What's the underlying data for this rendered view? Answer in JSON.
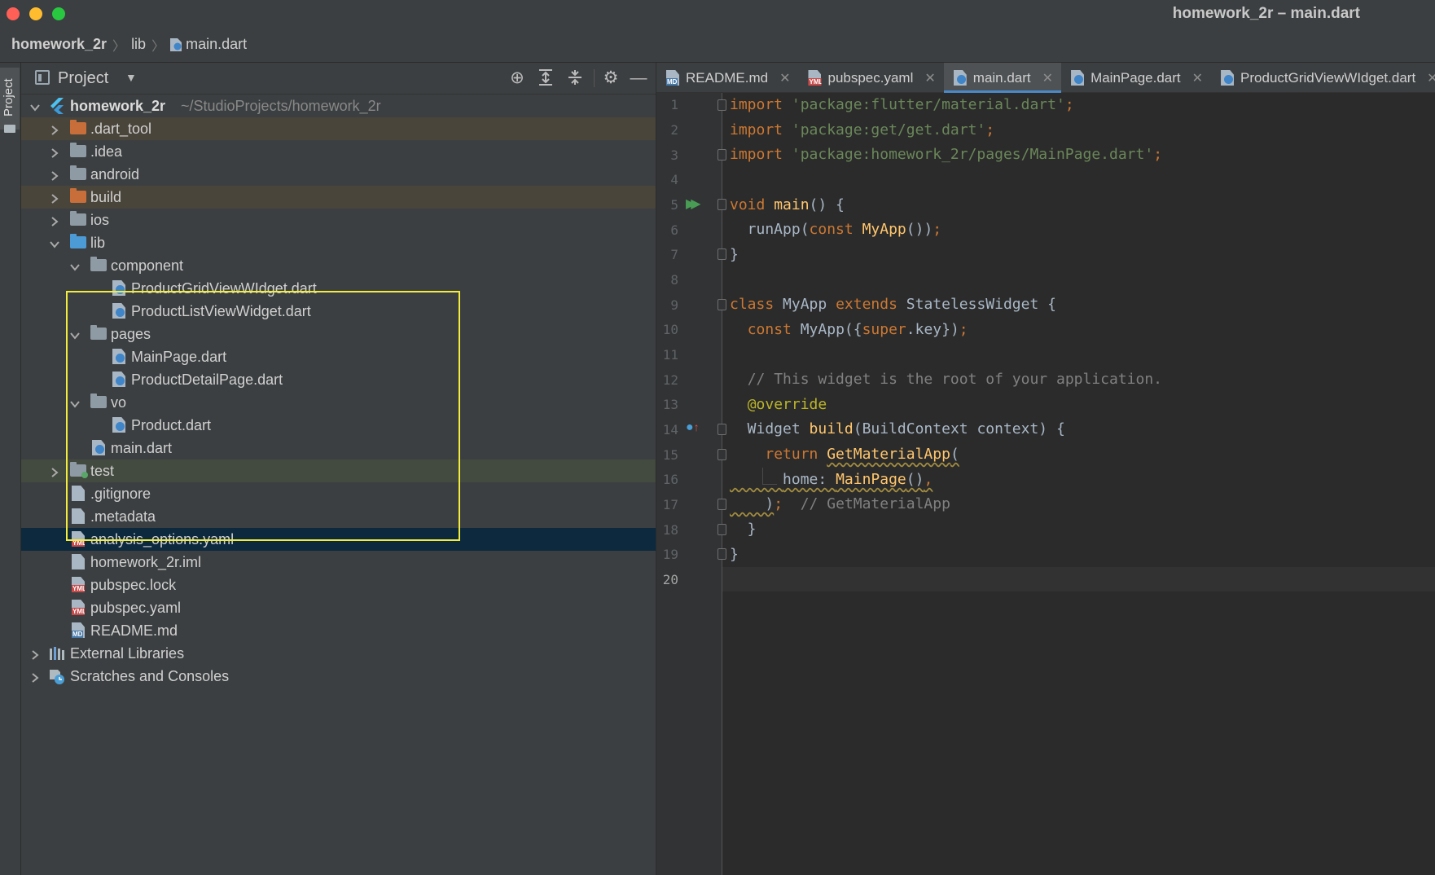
{
  "window": {
    "title": "homework_2r – main.dart"
  },
  "breadcrumb": [
    "homework_2r",
    "lib",
    "main.dart"
  ],
  "sidebar_strip": {
    "label": "Project"
  },
  "project_panel": {
    "title": "Project",
    "tree": [
      {
        "label": "homework_2r",
        "suffix": "~/StudioProjects/homework_2r",
        "type": "module",
        "depth": 0,
        "expanded": true
      },
      {
        "label": ".dart_tool",
        "type": "folder-excluded",
        "depth": 1,
        "expanded": false
      },
      {
        "label": ".idea",
        "type": "folder-config",
        "depth": 1,
        "expanded": false
      },
      {
        "label": "android",
        "type": "folder",
        "depth": 1,
        "expanded": false
      },
      {
        "label": "build",
        "type": "folder-excluded",
        "depth": 1,
        "expanded": false
      },
      {
        "label": "ios",
        "type": "folder",
        "depth": 1,
        "expanded": false
      },
      {
        "label": "lib",
        "type": "folder-source",
        "depth": 1,
        "expanded": true
      },
      {
        "label": "component",
        "type": "folder",
        "depth": 2,
        "expanded": true
      },
      {
        "label": "ProductGridViewWIdget.dart",
        "type": "dart",
        "depth": 3
      },
      {
        "label": "ProductListViewWidget.dart",
        "type": "dart",
        "depth": 3
      },
      {
        "label": "pages",
        "type": "folder",
        "depth": 2,
        "expanded": true
      },
      {
        "label": "MainPage.dart",
        "type": "dart",
        "depth": 3
      },
      {
        "label": "ProductDetailPage.dart",
        "type": "dart",
        "depth": 3
      },
      {
        "label": "vo",
        "type": "folder",
        "depth": 2,
        "expanded": true
      },
      {
        "label": "Product.dart",
        "type": "dart",
        "depth": 3
      },
      {
        "label": "main.dart",
        "type": "dart",
        "depth": 2
      },
      {
        "label": "test",
        "type": "folder-test",
        "depth": 1,
        "expanded": false
      },
      {
        "label": ".gitignore",
        "type": "file",
        "depth": 1
      },
      {
        "label": ".metadata",
        "type": "file",
        "depth": 1
      },
      {
        "label": "analysis_options.yaml",
        "type": "yml",
        "depth": 1,
        "selected": true
      },
      {
        "label": "homework_2r.iml",
        "type": "file",
        "depth": 1
      },
      {
        "label": "pubspec.lock",
        "type": "yml",
        "depth": 1
      },
      {
        "label": "pubspec.yaml",
        "type": "yml",
        "depth": 1
      },
      {
        "label": "README.md",
        "type": "md",
        "depth": 1
      },
      {
        "label": "External Libraries",
        "type": "libraries",
        "depth": 0,
        "expanded": false
      },
      {
        "label": "Scratches and Consoles",
        "type": "scratches",
        "depth": 0,
        "expanded": false
      }
    ]
  },
  "tabs": [
    {
      "label": "README.md",
      "icon": "md",
      "active": false
    },
    {
      "label": "pubspec.yaml",
      "icon": "yml",
      "active": false
    },
    {
      "label": "main.dart",
      "icon": "dart",
      "active": true
    },
    {
      "label": "MainPage.dart",
      "icon": "dart",
      "active": false
    },
    {
      "label": "ProductGridViewWIdget.dart",
      "icon": "dart",
      "active": false
    }
  ],
  "editor": {
    "current_line": 20,
    "lines": [
      "import 'package:flutter/material.dart';",
      "import 'package:get/get.dart';",
      "import 'package:homework_2r/pages/MainPage.dart';",
      "",
      "void main() {",
      "  runApp(const MyApp());",
      "}",
      "",
      "class MyApp extends StatelessWidget {",
      "  const MyApp({super.key});",
      "",
      "  // This widget is the root of your application.",
      "  @override",
      "  Widget build(BuildContext context) {",
      "    return GetMaterialApp(",
      "      home: MainPage(),",
      "    );  // GetMaterialApp",
      "  }",
      "}",
      ""
    ]
  },
  "colors": {
    "highlight_box": "#f2ec3c",
    "selection": "#0d293e",
    "tab_underline": "#4a88c7"
  }
}
